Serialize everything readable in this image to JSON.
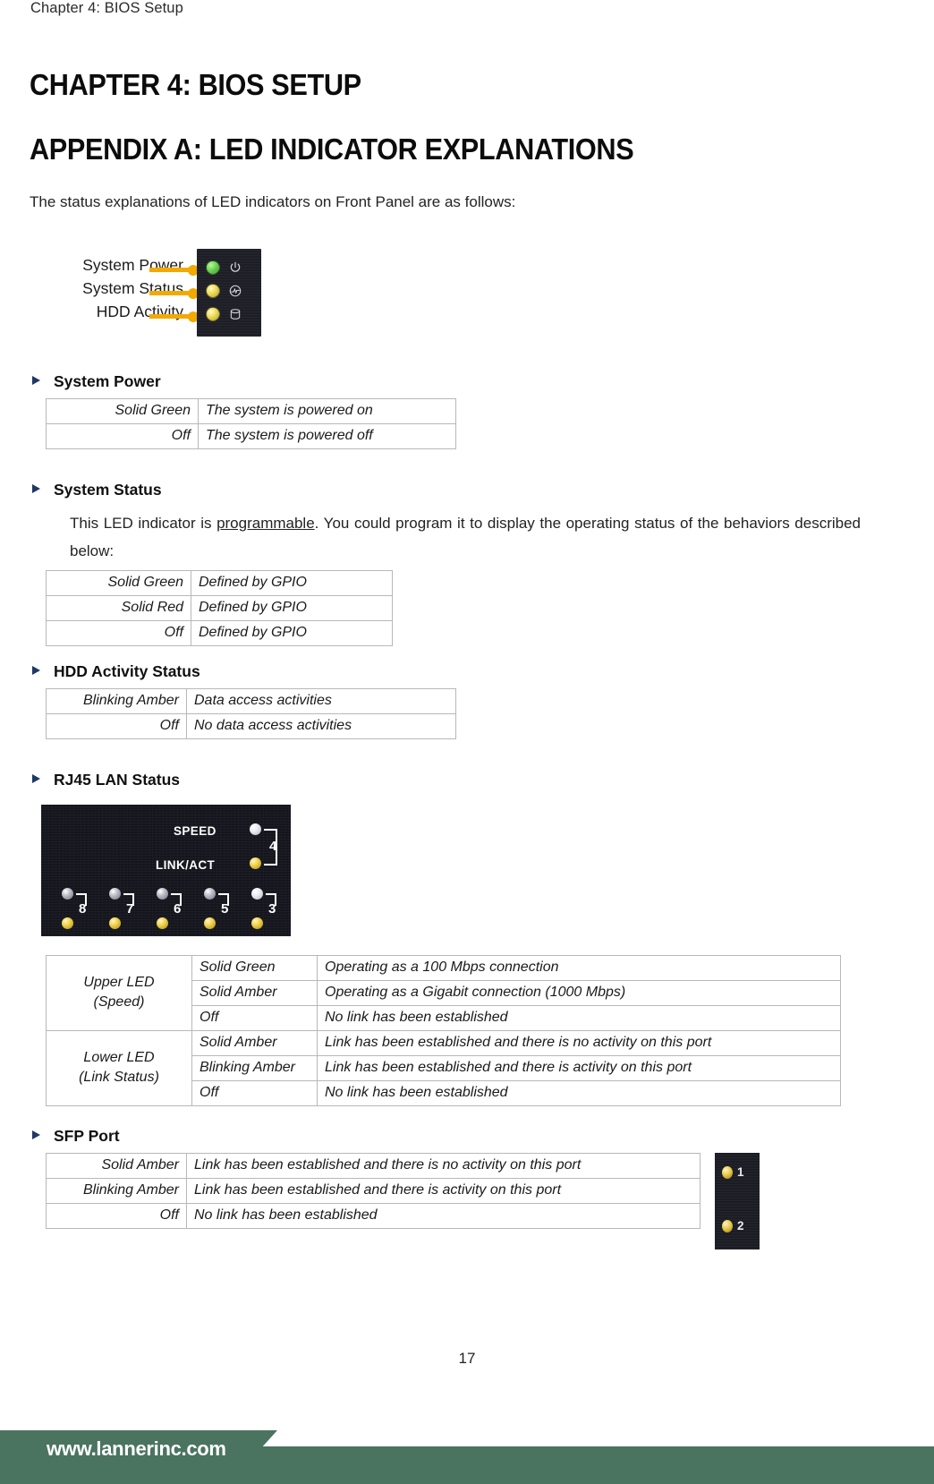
{
  "header": {
    "running_header": "Chapter 4: BIOS Setup"
  },
  "headings": {
    "chapter": "CHAPTER 4: BIOS SETUP",
    "appendix": "APPENDIX A: LED INDICATOR EXPLANATIONS"
  },
  "intro": "The status explanations of LED indicators on Front Panel are as follows:",
  "front_panel_figure": {
    "labels": [
      "System Power",
      "System Status",
      "HDD Activity"
    ],
    "leds": [
      {
        "icon": "power-icon",
        "color": "#5fd043"
      },
      {
        "icon": "system-status-icon",
        "color": "#ecd84a"
      },
      {
        "icon": "hdd-icon",
        "color": "#ecd84a"
      }
    ]
  },
  "sections": {
    "system_power": {
      "title": "System Power",
      "rows": [
        {
          "state": "Solid Green",
          "state_class": "c-green",
          "desc": "The system is powered on"
        },
        {
          "state": "Off",
          "state_class": "c-off",
          "desc": "The system is powered off"
        }
      ]
    },
    "system_status": {
      "title": "System Status",
      "paragraph_before": "This LED indicator is ",
      "paragraph_link": "programmable",
      "paragraph_after": ". You could program it to display the operating status of the behaviors described below:",
      "rows": [
        {
          "state": "Solid Green",
          "state_class": "c-green",
          "desc": "Defined by GPIO"
        },
        {
          "state": "Solid Red",
          "state_class": "c-red",
          "desc": "Defined by GPIO"
        },
        {
          "state": "Off",
          "state_class": "c-off",
          "desc": "Defined by GPIO"
        }
      ]
    },
    "hdd_activity": {
      "title": "HDD Activity Status",
      "rows": [
        {
          "state": "Blinking Amber",
          "state_class": "c-amber",
          "desc": "Data access activities"
        },
        {
          "state": "Off",
          "state_class": "c-off",
          "desc": "No data access activities"
        }
      ]
    },
    "rj45": {
      "title": "RJ45 LAN Status",
      "figure": {
        "speed_label": "SPEED",
        "linkact_label": "LINK/ACT",
        "highlight_port": "4",
        "port_numbers": [
          "8",
          "7",
          "6",
          "5",
          "3"
        ]
      },
      "groups": [
        {
          "name_line1": "Upper LED",
          "name_line2": "(Speed)",
          "rows": [
            {
              "state": "Solid Green",
              "state_class": "c-green",
              "desc": "Operating as a 100 Mbps connection"
            },
            {
              "state": "Solid Amber",
              "state_class": "c-amber",
              "desc": "Operating as a Gigabit connection (1000 Mbps)"
            },
            {
              "state": "Off",
              "state_class": "c-off",
              "desc": "No link has been established"
            }
          ]
        },
        {
          "name_line1": "Lower LED",
          "name_line2": "(Link Status)",
          "rows": [
            {
              "state": "Solid Amber",
              "state_class": "c-amber",
              "desc": "Link has been established and there is no activity on this port"
            },
            {
              "state": "Blinking Amber",
              "state_class": "c-amber",
              "desc": "Link has been established and there is activity on this port"
            },
            {
              "state": "Off",
              "state_class": "c-off",
              "desc": "No link has been established"
            }
          ]
        }
      ]
    },
    "sfp": {
      "title": "SFP Port",
      "rows": [
        {
          "state": "Solid Amber",
          "state_class": "c-amber",
          "desc": "Link has been established and there is no activity on this port"
        },
        {
          "state": "Blinking Amber",
          "state_class": "c-amber",
          "desc": "Link has been established and there is activity on this port"
        },
        {
          "state": "Off",
          "state_class": "c-off",
          "desc": "No link has been established"
        }
      ],
      "figure": {
        "port_numbers": [
          "1",
          "2"
        ]
      }
    }
  },
  "footer": {
    "page_number": "17",
    "website": "www.lannerinc.com",
    "band_color": "#4a7460"
  }
}
